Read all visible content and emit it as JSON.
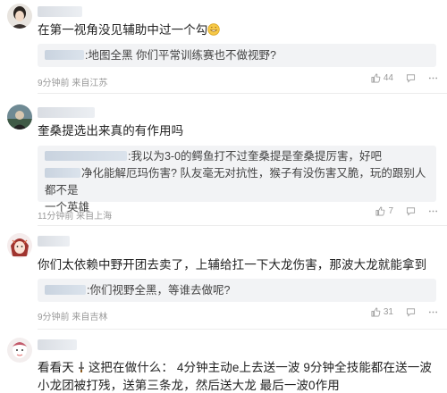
{
  "comments": [
    {
      "text": "在第一视角没见辅助中过一个勾",
      "reply": {
        "text": ":地图全黑 你们平常训练赛也不做视野?"
      },
      "meta": {
        "time": "9分钟前",
        "location": "来自江苏"
      },
      "likes": "44"
    },
    {
      "text": "奎桑提选出来真的有作用吗",
      "reply": {
        "text_line1": ":我以为3-0的鳄鱼打不过奎桑提是奎桑提厉害，好吧",
        "text_line2": "净化能解厄玛伤害? 队友毫无对抗性，猴子有没伤害又脆，玩的跟别人都不是",
        "text_line3": "一个英雄"
      },
      "meta": {
        "time": "11分钟前",
        "location": "来自上海"
      },
      "likes": "7"
    },
    {
      "text": "你们太依赖中野开团去卖了，上辅给扛一下大龙伤害，那波大龙就能拿到",
      "reply": {
        "text": ":你们视野全黑，等谁去做呢?"
      },
      "meta": {
        "time": "9分钟前",
        "location": "来自吉林"
      },
      "likes": "31"
    },
    {
      "text_line1": "看看天",
      "text_line1b": "这把在做什么： 4分钟主动e上去送一波 9分钟全技能都在送一波",
      "text_line2": "小龙团被打残，送第三条龙，然后送大龙 最后一波0作用"
    }
  ],
  "icons": {
    "like": "thumbs-up-icon",
    "reply": "comment-icon",
    "more": "more-dots-icon"
  },
  "colors": {
    "meta": "#999999",
    "reply_bg": "#f2f3f5",
    "text": "#222222"
  }
}
